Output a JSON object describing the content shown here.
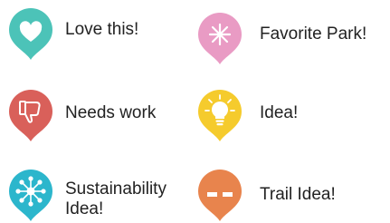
{
  "legend": {
    "items": [
      {
        "label": "Love this!",
        "icon": "heart-icon",
        "color": "#4CC3B8"
      },
      {
        "label": "Favorite Park!",
        "icon": "asterisk-icon",
        "color": "#E99BC4"
      },
      {
        "label": "Needs work",
        "icon": "thumbs-down-icon",
        "color": "#D9605A"
      },
      {
        "label": "Idea!",
        "icon": "lightbulb-icon",
        "color": "#F5CB2D"
      },
      {
        "label": "Sustainability Idea!",
        "icon": "network-icon",
        "color": "#2CB6CC"
      },
      {
        "label": "Trail Idea!",
        "icon": "dashed-trail-icon",
        "color": "#E8844D"
      }
    ]
  }
}
